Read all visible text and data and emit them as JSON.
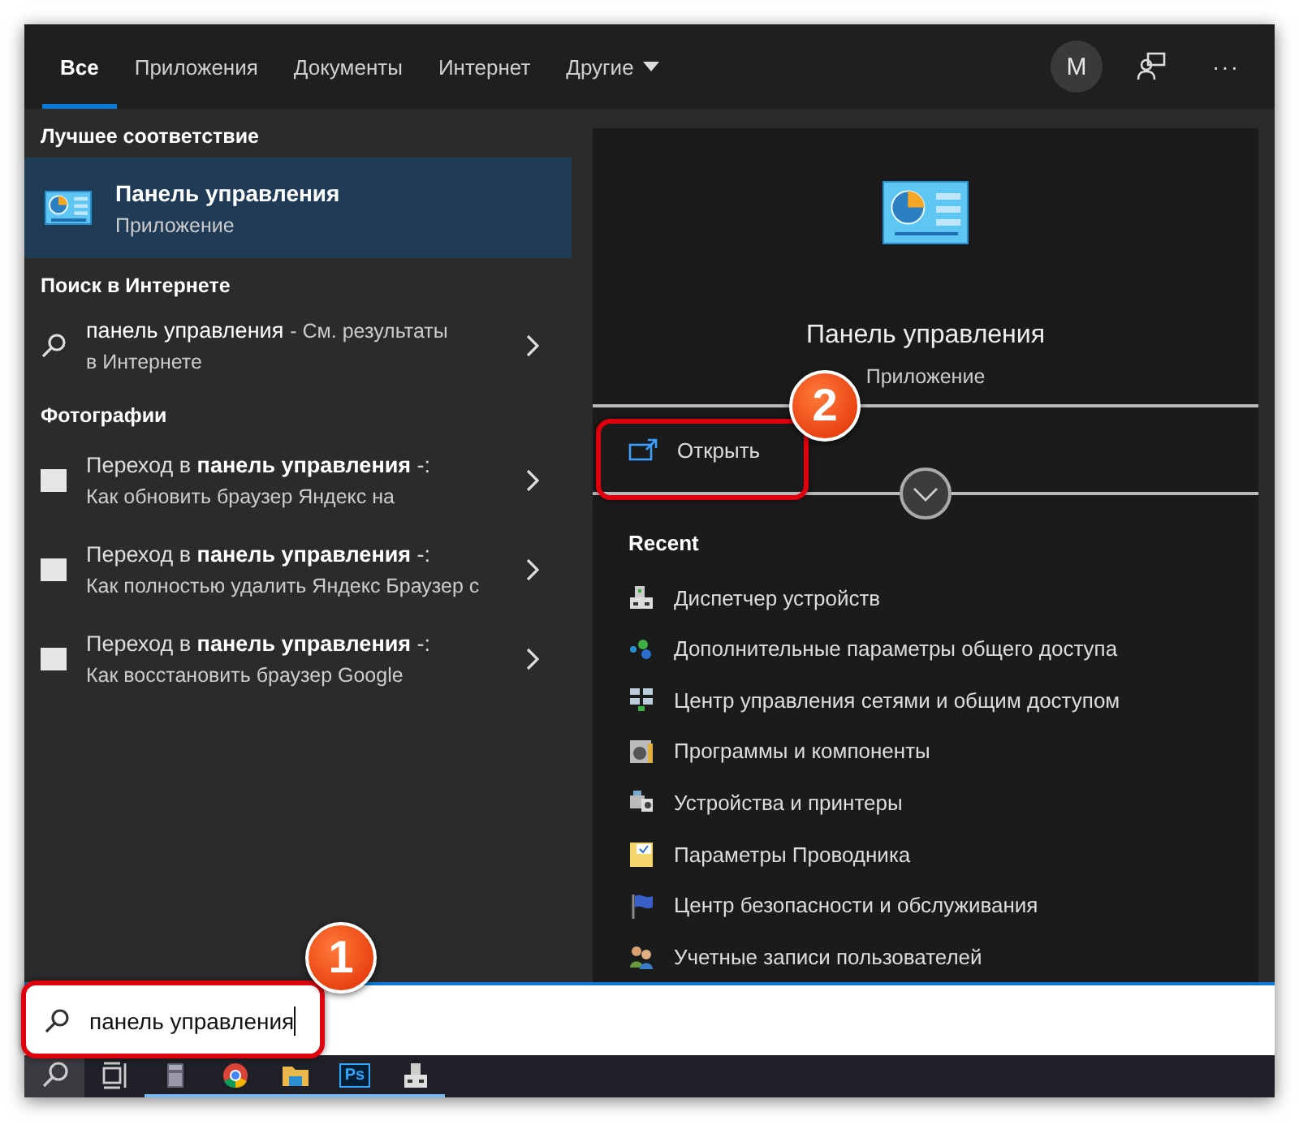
{
  "tabs": [
    {
      "label": "Все",
      "selected": true
    },
    {
      "label": "Приложения",
      "selected": false
    },
    {
      "label": "Документы",
      "selected": false
    },
    {
      "label": "Интернет",
      "selected": false
    },
    {
      "label": "Другие",
      "selected": false,
      "dropdown": true
    }
  ],
  "account": {
    "initial": "M"
  },
  "more": "···",
  "best_match": {
    "header": "Лучшее соответствие",
    "title": "Панель управления",
    "subtitle": "Приложение",
    "selected": true
  },
  "web_search": {
    "header": "Поиск в Интернете",
    "query": "панель управления",
    "suffix": "- См. результаты",
    "line2": "в Интернете"
  },
  "photos": {
    "header": "Фотографии",
    "items": [
      {
        "title": "Переход в **панель управления** -:",
        "subtitle": "Как обновить браузер Яндекс на"
      },
      {
        "title": "Переход в **панель управления** -:",
        "subtitle": "Как полностью удалить Яндекс Браузер с"
      },
      {
        "title": "Переход в **панель управления** -:",
        "subtitle": "Как восстановить браузер Google"
      }
    ]
  },
  "preview": {
    "title": "Панель управления",
    "subtitle": "Приложение",
    "open": "Открыть",
    "recent_header": "Recent",
    "recent": [
      "Диспетчер устройств",
      "Дополнительные параметры общего доступа",
      "Центр управления сетями и общим доступом",
      "Программы и компоненты",
      "Устройства и принтеры",
      "Параметры Проводника",
      "Центр безопасности и обслуживания",
      "Учетные записи пользователей"
    ]
  },
  "search": {
    "value": "панель управления"
  },
  "taskbar": [
    {
      "running": false
    },
    {
      "running": false
    },
    {
      "running": true
    },
    {
      "running": true
    },
    {
      "running": true
    },
    {
      "running": true,
      "label": "Ps"
    },
    {
      "running": true
    }
  ],
  "callouts": [
    {
      "number": "1",
      "kind": "search"
    },
    {
      "number": "2",
      "kind": "open"
    }
  ]
}
